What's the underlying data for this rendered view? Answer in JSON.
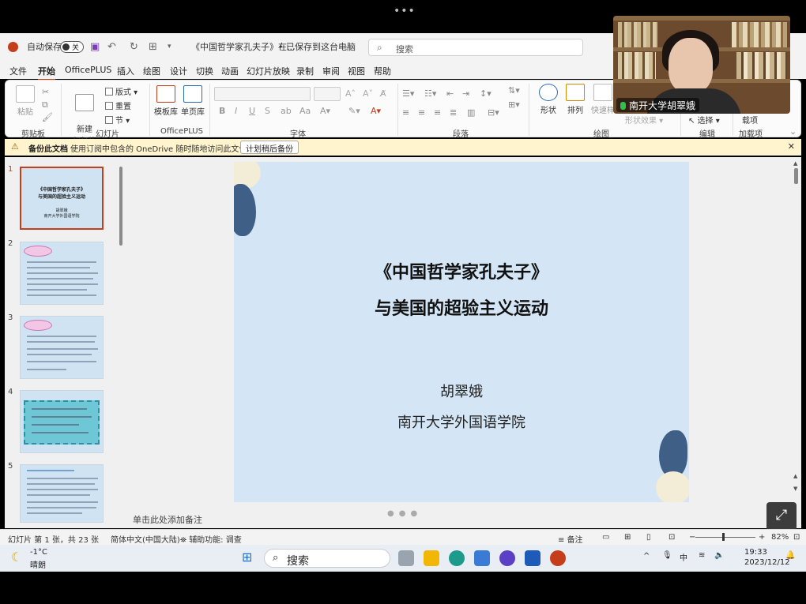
{
  "title_bar": {
    "autosave_label": "自动保存",
    "autosave_state": "关",
    "document_title": "《中国哲学家孔夫子》在...",
    "save_status": "• 已保存到这台电脑",
    "search_placeholder": "搜索"
  },
  "menu": {
    "items": [
      "文件",
      "开始",
      "OfficePLUS",
      "插入",
      "绘图",
      "设计",
      "切换",
      "动画",
      "幻灯片放映",
      "录制",
      "审阅",
      "视图",
      "帮助"
    ],
    "active": "开始"
  },
  "ribbon": {
    "clipboard": {
      "label": "剪贴板",
      "paste": "粘贴"
    },
    "slides": {
      "label": "幻灯片",
      "new_slide": "新建\n幻灯片",
      "layout": "版式",
      "reset": "重置",
      "section": "节"
    },
    "officeplus": {
      "label": "OfficePLUS",
      "template_lib": "模板库",
      "single_page_lib": "单页库"
    },
    "font": {
      "label": "字体"
    },
    "paragraph": {
      "label": "段落"
    },
    "drawing": {
      "label": "绘图",
      "shape": "形状",
      "arrange": "排列",
      "quick_styles": "快速样",
      "shape_effects": "形状效果"
    },
    "editing": {
      "label": "编辑",
      "select": "选择"
    },
    "addins": {
      "label": "加载项",
      "addins_btn": "载项"
    }
  },
  "notification": {
    "bold": "备份此文档",
    "message": "使用订阅中包含的 OneDrive 随时随地访问此文件。",
    "button": "计划稍后备份"
  },
  "thumbnails": [
    {
      "num": "1",
      "title1": "《中国哲学家孔夫子》",
      "title2": "与美国的超验主义运动",
      "author": "胡翠娥",
      "inst": "南开大学外国语学院"
    },
    {
      "num": "2"
    },
    {
      "num": "3"
    },
    {
      "num": "4"
    },
    {
      "num": "5"
    }
  ],
  "slide": {
    "title1": "《中国哲学家孔夫子》",
    "title2": "与美国的超验主义运动",
    "author": "胡翠娥",
    "institution": "南开大学外国语学院"
  },
  "notes_placeholder": "单击此处添加备注",
  "status_bar": {
    "slide_count": "幻灯片 第 1 张，共 23 张",
    "language": "简体中文(中国大陆)",
    "accessibility": "辅助功能: 调查",
    "notes": "备注",
    "zoom": "82%"
  },
  "taskbar": {
    "weather_temp": "-1°C",
    "weather_desc": "晴朗",
    "search": "搜索",
    "ime": "中",
    "time": "19:33",
    "date": "2023/12/12"
  },
  "video": {
    "participant_name": "南开大学胡翠娥"
  },
  "colors": {
    "accent": "#c43e1c",
    "slide_bg": "#d4e6f5",
    "notification_bg": "#fff4ce"
  }
}
